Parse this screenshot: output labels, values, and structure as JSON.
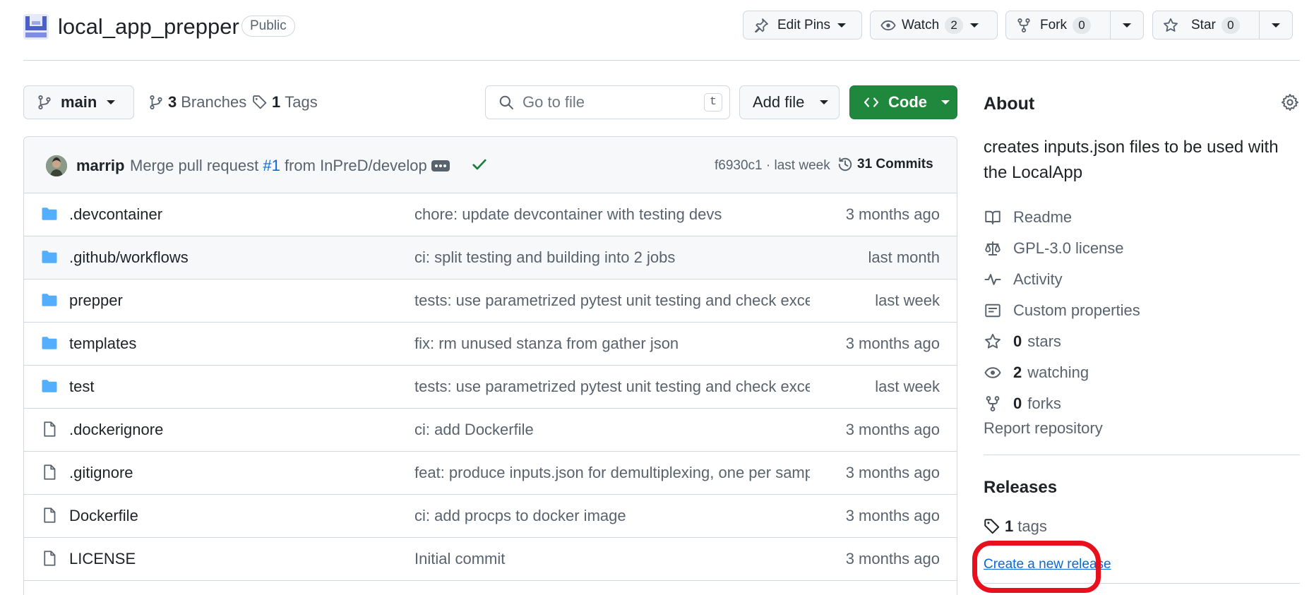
{
  "repo": {
    "name": "local_app_prepper",
    "visibility": "Public"
  },
  "header_actions": {
    "edit_pins": "Edit Pins",
    "watch": {
      "label": "Watch",
      "count": "2"
    },
    "fork": {
      "label": "Fork",
      "count": "0"
    },
    "star": {
      "label": "Star",
      "count": "0"
    }
  },
  "toolbar": {
    "branch": "main",
    "branches_count": "3",
    "branches_label": "Branches",
    "tags_count": "1",
    "tags_label": "Tags",
    "search_placeholder": "Go to file",
    "search_shortcut": "t",
    "add_file": "Add file",
    "code": "Code"
  },
  "latest_commit": {
    "author": "marrip",
    "message_prefix": "Merge pull request",
    "pr": "#1",
    "message_suffix": "from InPreD/develop",
    "hash_time": "f6930c1 · last week",
    "commits_label": "31 Commits",
    "status_color": "#1a7f37"
  },
  "files": [
    {
      "type": "folder",
      "name": ".devcontainer",
      "message": "chore: update devcontainer with testing devs",
      "date": "3 months ago"
    },
    {
      "type": "folder",
      "name": ".github/workflows",
      "message": "ci: split testing and building into 2 jobs",
      "date": "last month"
    },
    {
      "type": "folder",
      "name": "prepper",
      "message": "tests: use parametrized pytest unit testing and check excep...",
      "date": "last week"
    },
    {
      "type": "folder",
      "name": "templates",
      "message": "fix: rm unused stanza from gather json",
      "date": "3 months ago"
    },
    {
      "type": "folder",
      "name": "test",
      "message": "tests: use parametrized pytest unit testing and check excep...",
      "date": "last week"
    },
    {
      "type": "file",
      "name": ".dockerignore",
      "message": "ci: add Dockerfile",
      "date": "3 months ago"
    },
    {
      "type": "file",
      "name": ".gitignore",
      "message": "feat: produce inputs.json for demultiplexing, one per sampl...",
      "date": "3 months ago"
    },
    {
      "type": "file",
      "name": "Dockerfile",
      "message": "ci: add procps to docker image",
      "date": "3 months ago"
    },
    {
      "type": "file",
      "name": "LICENSE",
      "message": "Initial commit",
      "date": "3 months ago"
    }
  ],
  "about": {
    "title": "About",
    "description": "creates inputs.json files to be used with the LocalApp",
    "items": [
      {
        "icon": "book-icon",
        "count": "",
        "label": "Readme"
      },
      {
        "icon": "law-icon",
        "count": "",
        "label": "GPL-3.0 license"
      },
      {
        "icon": "pulse-icon",
        "count": "",
        "label": "Activity"
      },
      {
        "icon": "note-icon",
        "count": "",
        "label": "Custom properties"
      },
      {
        "icon": "star-icon",
        "count": "0",
        "label": "stars"
      },
      {
        "icon": "eye-icon",
        "count": "2",
        "label": "watching"
      },
      {
        "icon": "fork-icon",
        "count": "0",
        "label": "forks"
      }
    ],
    "report": "Report repository"
  },
  "releases": {
    "title": "Releases",
    "tags_count": "1",
    "tags_label": "tags",
    "create_link": "Create a new release",
    "highlight_color": "#e8101d"
  },
  "colors": {
    "accent": "#0969da",
    "primary_button": "#1f883d",
    "folder": "#54aeff",
    "muted_text": "#59636e"
  }
}
